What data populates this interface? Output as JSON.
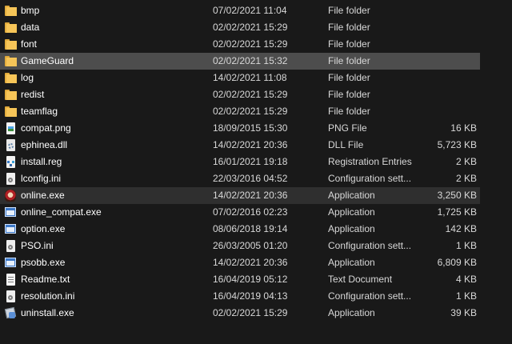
{
  "files": [
    {
      "name": "bmp",
      "date": "07/02/2021 11:04",
      "type": "File folder",
      "size": "",
      "icon": "folder-icon"
    },
    {
      "name": "data",
      "date": "02/02/2021 15:29",
      "type": "File folder",
      "size": "",
      "icon": "folder-icon"
    },
    {
      "name": "font",
      "date": "02/02/2021 15:29",
      "type": "File folder",
      "size": "",
      "icon": "folder-icon"
    },
    {
      "name": "GameGuard",
      "date": "02/02/2021 15:32",
      "type": "File folder",
      "size": "",
      "icon": "folder-icon"
    },
    {
      "name": "log",
      "date": "14/02/2021 11:08",
      "type": "File folder",
      "size": "",
      "icon": "folder-icon"
    },
    {
      "name": "redist",
      "date": "02/02/2021 15:29",
      "type": "File folder",
      "size": "",
      "icon": "folder-icon"
    },
    {
      "name": "teamflag",
      "date": "02/02/2021 15:29",
      "type": "File folder",
      "size": "",
      "icon": "folder-icon"
    },
    {
      "name": "compat.png",
      "date": "18/09/2015 15:30",
      "type": "PNG File",
      "size": "16 KB",
      "icon": "image-icon"
    },
    {
      "name": "ephinea.dll",
      "date": "14/02/2021 20:36",
      "type": "DLL File",
      "size": "5,723 KB",
      "icon": "gear-doc-icon"
    },
    {
      "name": "install.reg",
      "date": "16/01/2021 19:18",
      "type": "Registration Entries",
      "size": "2 KB",
      "icon": "registry-icon"
    },
    {
      "name": "lconfig.ini",
      "date": "22/03/2016 04:52",
      "type": "Configuration sett...",
      "size": "2 KB",
      "icon": "config-icon"
    },
    {
      "name": "online.exe",
      "date": "14/02/2021 20:36",
      "type": "Application",
      "size": "3,250 KB",
      "icon": "game-icon"
    },
    {
      "name": "online_compat.exe",
      "date": "07/02/2016 02:23",
      "type": "Application",
      "size": "1,725 KB",
      "icon": "app-icon"
    },
    {
      "name": "option.exe",
      "date": "08/06/2018 19:14",
      "type": "Application",
      "size": "142 KB",
      "icon": "app-icon"
    },
    {
      "name": "PSO.ini",
      "date": "26/03/2005 01:20",
      "type": "Configuration sett...",
      "size": "1 KB",
      "icon": "config-icon"
    },
    {
      "name": "psobb.exe",
      "date": "14/02/2021 20:36",
      "type": "Application",
      "size": "6,809 KB",
      "icon": "app-icon"
    },
    {
      "name": "Readme.txt",
      "date": "16/04/2019 05:12",
      "type": "Text Document",
      "size": "4 KB",
      "icon": "doc-icon"
    },
    {
      "name": "resolution.ini",
      "date": "16/04/2019 04:13",
      "type": "Configuration sett...",
      "size": "1 KB",
      "icon": "config-icon"
    },
    {
      "name": "uninstall.exe",
      "date": "02/02/2021 15:29",
      "type": "Application",
      "size": "39 KB",
      "icon": "uninstall-icon"
    }
  ],
  "hovered_row": "GameGuard",
  "selected_row": "online.exe",
  "colors": {
    "background": "#191919",
    "hover": "#4d4d4d",
    "selected": "#2f2f2f",
    "text": "#ffffff",
    "secondary_text": "#d8d8d8"
  }
}
